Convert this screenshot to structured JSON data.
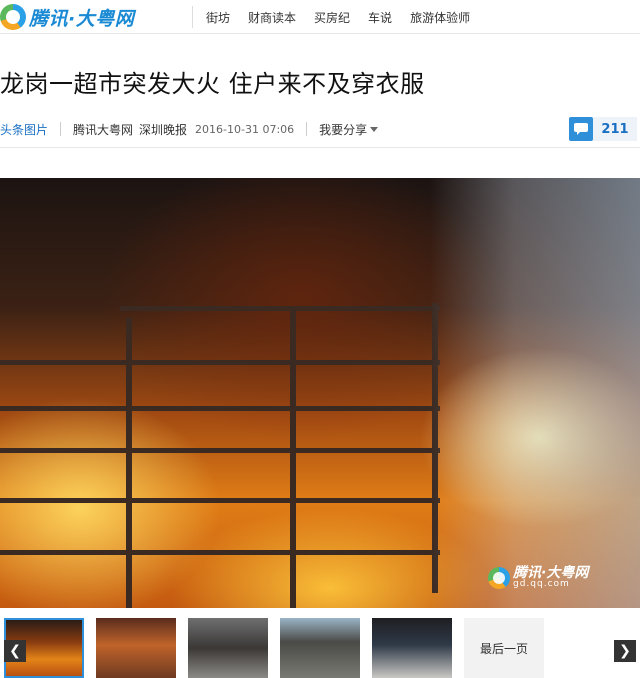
{
  "header": {
    "logo_text_a": "腾讯·",
    "logo_text_b": "大粤网",
    "nav": [
      "街坊",
      "财商读本",
      "买房纪",
      "车说",
      "旅游体验师"
    ]
  },
  "article": {
    "title": "龙岗一超市突发大火 住户来不及穿衣服",
    "tag": "头条图片",
    "source": "腾讯大粤网",
    "paper": "深圳晚报",
    "time": "2016-10-31 07:06",
    "share_label": "我要分享",
    "comment_count": "211"
  },
  "photo": {
    "watermark_title": "腾讯·大粤网",
    "watermark_url": "gd.qq.com"
  },
  "gallery": {
    "last_page_label": "最后一页",
    "prev_icon": "chevron-left-icon",
    "next_icon": "chevron-right-icon"
  },
  "colors": {
    "brand_blue": "#1a8ad4",
    "link_blue": "#1a6fc2",
    "comment_blue": "#2f8fd8"
  }
}
